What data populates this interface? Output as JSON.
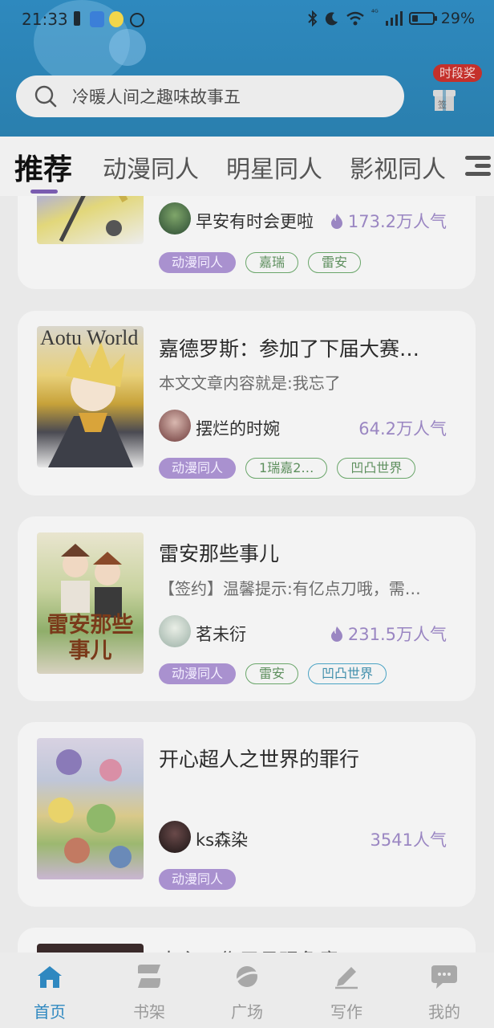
{
  "status_bar": {
    "time": "21:33",
    "network": "⁴ᴳ",
    "battery": "29%"
  },
  "header": {
    "search_placeholder": "冷暖人间之趣味故事五",
    "gift_badge": "时段奖",
    "gift_mark": "签"
  },
  "tabs": [
    {
      "label": "推荐",
      "active": true
    },
    {
      "label": "动漫同人"
    },
    {
      "label": "明星同人"
    },
    {
      "label": "影视同人"
    }
  ],
  "books": [
    {
      "title": "",
      "desc": "",
      "author": "早安有时会更啦",
      "popularity": "173.2万人气",
      "flame": true,
      "tags": [
        {
          "text": "动漫同人",
          "style": "cat"
        },
        {
          "text": "嘉瑞",
          "style": "green"
        },
        {
          "text": "雷安",
          "style": "green"
        }
      ]
    },
    {
      "title": "嘉德罗斯：参加了下届大赛…",
      "desc": "本文文章内容就是:我忘了",
      "author": "摆烂的时婉",
      "popularity": "64.2万人气",
      "flame": false,
      "cover_text": "Aotu World",
      "tags": [
        {
          "text": "动漫同人",
          "style": "cat"
        },
        {
          "text": "1瑞嘉2…",
          "style": "green"
        },
        {
          "text": "凹凸世界",
          "style": "green"
        }
      ]
    },
    {
      "title": "雷安那些事儿",
      "desc": "【签约】温馨提示:有亿点刀哦，需…",
      "author": "茗未衍",
      "popularity": "231.5万人气",
      "flame": true,
      "cover_text": "雷安那些事儿",
      "tags": [
        {
          "text": "动漫同人",
          "style": "cat"
        },
        {
          "text": "雷安",
          "style": "green"
        },
        {
          "text": "凹凸世界",
          "style": "blue"
        }
      ]
    },
    {
      "title": "开心超人之世界的罪行",
      "desc": "",
      "author": "ks森染",
      "popularity": "3541人气",
      "flame": false,
      "tags": [
        {
          "text": "动漫同人",
          "style": "cat"
        }
      ]
    },
    {
      "title": "大主…作用月现危意!…"
    }
  ],
  "bottom_nav": [
    {
      "label": "首页",
      "icon": "home-icon",
      "active": true
    },
    {
      "label": "书架",
      "icon": "bookshelf-icon"
    },
    {
      "label": "广场",
      "icon": "planet-icon"
    },
    {
      "label": "写作",
      "icon": "pen-icon"
    },
    {
      "label": "我的",
      "icon": "chat-bubble-icon"
    }
  ],
  "colors": {
    "header_blue": "#2e89be",
    "accent_purple": "#a991cf",
    "nav_active": "#2f88c0"
  }
}
